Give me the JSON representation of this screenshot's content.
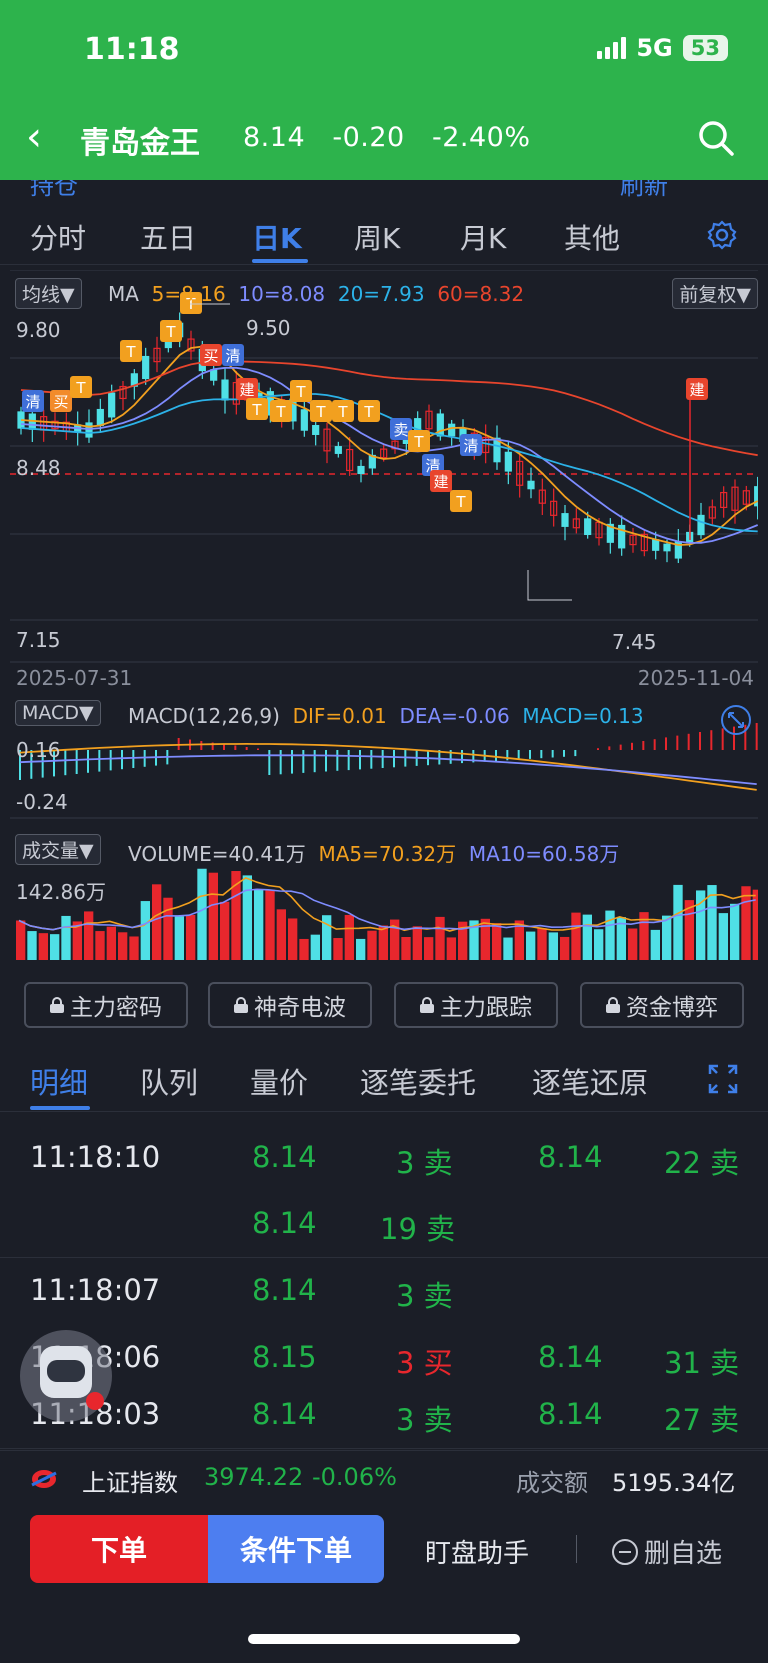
{
  "status_bar": {
    "time": "11:18",
    "network": "5G",
    "battery": "53"
  },
  "header": {
    "back_icon": "chevron-left-icon",
    "stock_name": "青岛金王",
    "price": "8.14",
    "change": "-0.20",
    "change_pct": "-2.40%",
    "search_icon": "search-icon"
  },
  "partial_row": {
    "left": "持仓",
    "right": "刷新"
  },
  "period_tabs": {
    "items": [
      "分时",
      "五日",
      "日K",
      "周K",
      "月K",
      "其他"
    ],
    "active": "日K",
    "settings_icon": "gear-icon"
  },
  "kline": {
    "indicator_select": "均线▼",
    "adjust_select": "前复权▼",
    "ma_label": "MA",
    "ma5": "5=8.16",
    "ma10": "10=8.08",
    "ma20": "20=7.93",
    "ma60": "60=8.32",
    "y_top": "9.80",
    "y_mid": "8.48",
    "y_bottom": "7.15",
    "high_mark": "9.50",
    "low_mark": "7.45",
    "date_start": "2025-07-31",
    "date_end": "2025-11-04",
    "colors": {
      "up": "#e8272d",
      "down": "#4fe0e6",
      "ma5": "#f2a01f",
      "ma10": "#7e8cff",
      "ma20": "#2cb2e8",
      "ma60": "#e8452d"
    },
    "signal_tags": [
      "清",
      "买",
      "卖",
      "建",
      "T"
    ]
  },
  "macd": {
    "select": "MACD▼",
    "params": "MACD(12,26,9)",
    "dif": "DIF=0.01",
    "dea": "DEA=-0.06",
    "macd": "MACD=0.13",
    "y_top": "0.16",
    "y_bottom": "-0.24",
    "expand_icon": "expand-icon"
  },
  "volume": {
    "select": "成交量▼",
    "volume": "VOLUME=40.41万",
    "ma5": "MA5=70.32万",
    "ma10": "MA10=60.58万",
    "y_top": "142.86万"
  },
  "tools": [
    "主力密码",
    "神奇电波",
    "主力跟踪",
    "资金博弈"
  ],
  "detail_tabs": {
    "items": [
      "明细",
      "队列",
      "量价",
      "逐笔委托",
      "逐笔还原"
    ],
    "active": "明细",
    "fullscreen_icon": "fullscreen-icon"
  },
  "trades": [
    {
      "time": "11:18:10",
      "p1": "8.14",
      "v1": "3 卖",
      "p2": "8.14",
      "v2": "22 卖"
    },
    {
      "time": "",
      "p1": "8.14",
      "v1": "19 卖",
      "p2": "",
      "v2": ""
    },
    {
      "time": "11:18:07",
      "p1": "8.14",
      "v1": "3 卖",
      "p2": "",
      "v2": ""
    },
    {
      "time": "11:18:06",
      "p1": "8.15",
      "v1": "3 买",
      "p2": "8.14",
      "v2": "31 卖"
    },
    {
      "time": "11:18:03",
      "p1": "8.14",
      "v1": "3 卖",
      "p2": "8.14",
      "v2": "27 卖"
    }
  ],
  "index_bar": {
    "name": "上证指数",
    "value": "3974.22",
    "change": "-0.06%",
    "turnover_label": "成交额",
    "turnover": "5195.34亿"
  },
  "bottom": {
    "order": "下单",
    "conditional": "条件下单",
    "helper": "盯盘助手",
    "remove": "删自选"
  }
}
